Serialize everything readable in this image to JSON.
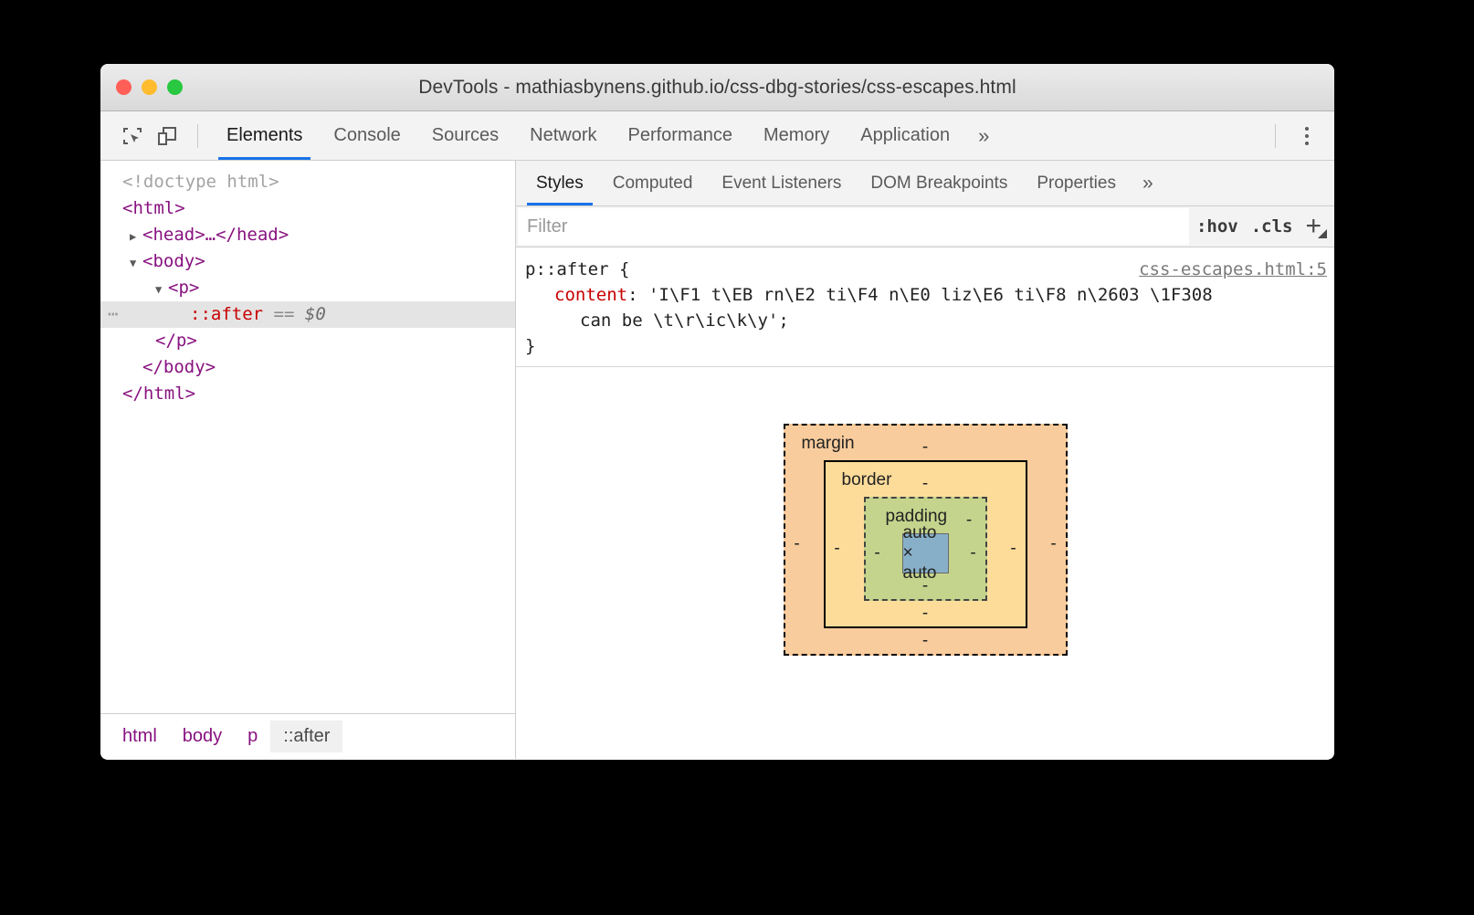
{
  "window": {
    "title": "DevTools - mathiasbynens.github.io/css-dbg-stories/css-escapes.html",
    "traffic_lights": [
      "close",
      "minimize",
      "zoom"
    ]
  },
  "toolbar": {
    "inspect_icon": "inspect-element-icon",
    "device_icon": "device-toolbar-icon",
    "tabs": [
      {
        "label": "Elements",
        "active": true
      },
      {
        "label": "Console",
        "active": false
      },
      {
        "label": "Sources",
        "active": false
      },
      {
        "label": "Network",
        "active": false
      },
      {
        "label": "Performance",
        "active": false
      },
      {
        "label": "Memory",
        "active": false
      },
      {
        "label": "Application",
        "active": false
      }
    ],
    "more_label": "»",
    "kebab_icon": "more-options-icon"
  },
  "dom_tree": {
    "nodes": [
      {
        "indent": 0,
        "twisty": "",
        "text": "<!doctype html>",
        "kind": "doctype",
        "selected": false,
        "ellipsis": false
      },
      {
        "indent": 0,
        "twisty": "",
        "text": "<html>",
        "kind": "tag",
        "selected": false,
        "ellipsis": false
      },
      {
        "indent": 1,
        "twisty": "▶",
        "text": "<head>…</head>",
        "kind": "tag",
        "selected": false,
        "ellipsis": false
      },
      {
        "indent": 1,
        "twisty": "▼",
        "text": "<body>",
        "kind": "tag",
        "selected": false,
        "ellipsis": false
      },
      {
        "indent": 2,
        "twisty": "▼",
        "text": "<p>",
        "kind": "tag",
        "selected": false,
        "ellipsis": false
      },
      {
        "indent": 3,
        "twisty": "",
        "text": "::after",
        "kind": "pseudo",
        "selected": true,
        "ellipsis": true,
        "suffix_eq": "==",
        "suffix_var": "$0"
      },
      {
        "indent": 2,
        "twisty": "",
        "text": "</p>",
        "kind": "tag",
        "selected": false,
        "ellipsis": false
      },
      {
        "indent": 1,
        "twisty": "",
        "text": "</body>",
        "kind": "tag",
        "selected": false,
        "ellipsis": false
      },
      {
        "indent": 0,
        "twisty": "",
        "text": "</html>",
        "kind": "tag",
        "selected": false,
        "ellipsis": false
      }
    ]
  },
  "breadcrumb": {
    "items": [
      {
        "label": "html",
        "active": false
      },
      {
        "label": "body",
        "active": false
      },
      {
        "label": "p",
        "active": false
      },
      {
        "label": "::after",
        "active": true
      }
    ]
  },
  "styles_panel": {
    "sub_tabs": [
      {
        "label": "Styles",
        "active": true
      },
      {
        "label": "Computed",
        "active": false
      },
      {
        "label": "Event Listeners",
        "active": false
      },
      {
        "label": "DOM Breakpoints",
        "active": false
      },
      {
        "label": "Properties",
        "active": false
      }
    ],
    "sub_more_label": "»",
    "filter": {
      "value": "",
      "placeholder": "Filter"
    },
    "hov_button": ":hov",
    "cls_button": ".cls",
    "plus_button": "+",
    "rule": {
      "selector": "p::after {",
      "source_link": "css-escapes.html:5",
      "property_name": "content",
      "property_colon": ": ",
      "value_line1": "'I\\F1 t\\EB rn\\E2 ti\\F4 n\\E0 liz\\E6 ti\\F8 n\\2603 \\1F308",
      "value_line2": "can be \\t\\r\\ic\\k\\y';",
      "closing_brace": "}"
    }
  },
  "box_model": {
    "margin_label": "margin",
    "margin_top": "-",
    "margin_right": "-",
    "margin_bottom": "-",
    "margin_left": "-",
    "border_label": "border",
    "border_top": "-",
    "border_right": "-",
    "border_bottom": "-",
    "border_left": "-",
    "padding_label": "padding",
    "padding_top": "-",
    "padding_right": "-",
    "padding_bottom": "-",
    "padding_left": "-",
    "content_size": "auto × auto",
    "colors": {
      "margin": "#f9cc9d",
      "border": "#fddc9a",
      "padding": "#c5d48c",
      "content": "#87b0c8"
    }
  },
  "accent_color": "#1a73e8"
}
